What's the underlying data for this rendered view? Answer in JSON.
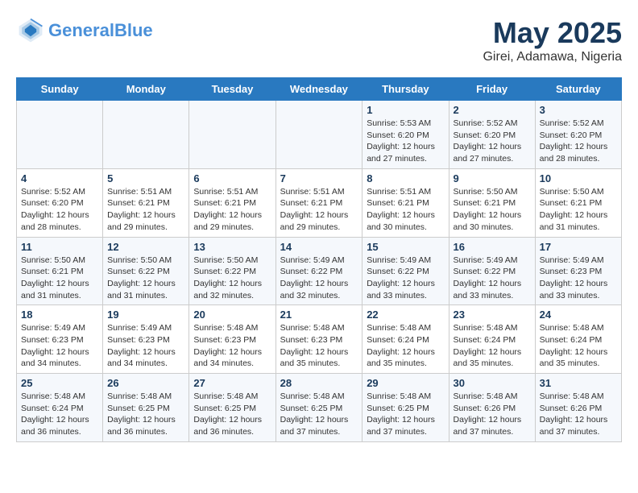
{
  "logo": {
    "text_general": "General",
    "text_blue": "Blue"
  },
  "header": {
    "month": "May 2025",
    "location": "Girei, Adamawa, Nigeria"
  },
  "weekdays": [
    "Sunday",
    "Monday",
    "Tuesday",
    "Wednesday",
    "Thursday",
    "Friday",
    "Saturday"
  ],
  "weeks": [
    [
      {
        "day": "",
        "info": ""
      },
      {
        "day": "",
        "info": ""
      },
      {
        "day": "",
        "info": ""
      },
      {
        "day": "",
        "info": ""
      },
      {
        "day": "1",
        "info": "Sunrise: 5:53 AM\nSunset: 6:20 PM\nDaylight: 12 hours\nand 27 minutes."
      },
      {
        "day": "2",
        "info": "Sunrise: 5:52 AM\nSunset: 6:20 PM\nDaylight: 12 hours\nand 27 minutes."
      },
      {
        "day": "3",
        "info": "Sunrise: 5:52 AM\nSunset: 6:20 PM\nDaylight: 12 hours\nand 28 minutes."
      }
    ],
    [
      {
        "day": "4",
        "info": "Sunrise: 5:52 AM\nSunset: 6:20 PM\nDaylight: 12 hours\nand 28 minutes."
      },
      {
        "day": "5",
        "info": "Sunrise: 5:51 AM\nSunset: 6:21 PM\nDaylight: 12 hours\nand 29 minutes."
      },
      {
        "day": "6",
        "info": "Sunrise: 5:51 AM\nSunset: 6:21 PM\nDaylight: 12 hours\nand 29 minutes."
      },
      {
        "day": "7",
        "info": "Sunrise: 5:51 AM\nSunset: 6:21 PM\nDaylight: 12 hours\nand 29 minutes."
      },
      {
        "day": "8",
        "info": "Sunrise: 5:51 AM\nSunset: 6:21 PM\nDaylight: 12 hours\nand 30 minutes."
      },
      {
        "day": "9",
        "info": "Sunrise: 5:50 AM\nSunset: 6:21 PM\nDaylight: 12 hours\nand 30 minutes."
      },
      {
        "day": "10",
        "info": "Sunrise: 5:50 AM\nSunset: 6:21 PM\nDaylight: 12 hours\nand 31 minutes."
      }
    ],
    [
      {
        "day": "11",
        "info": "Sunrise: 5:50 AM\nSunset: 6:21 PM\nDaylight: 12 hours\nand 31 minutes."
      },
      {
        "day": "12",
        "info": "Sunrise: 5:50 AM\nSunset: 6:22 PM\nDaylight: 12 hours\nand 31 minutes."
      },
      {
        "day": "13",
        "info": "Sunrise: 5:50 AM\nSunset: 6:22 PM\nDaylight: 12 hours\nand 32 minutes."
      },
      {
        "day": "14",
        "info": "Sunrise: 5:49 AM\nSunset: 6:22 PM\nDaylight: 12 hours\nand 32 minutes."
      },
      {
        "day": "15",
        "info": "Sunrise: 5:49 AM\nSunset: 6:22 PM\nDaylight: 12 hours\nand 33 minutes."
      },
      {
        "day": "16",
        "info": "Sunrise: 5:49 AM\nSunset: 6:22 PM\nDaylight: 12 hours\nand 33 minutes."
      },
      {
        "day": "17",
        "info": "Sunrise: 5:49 AM\nSunset: 6:23 PM\nDaylight: 12 hours\nand 33 minutes."
      }
    ],
    [
      {
        "day": "18",
        "info": "Sunrise: 5:49 AM\nSunset: 6:23 PM\nDaylight: 12 hours\nand 34 minutes."
      },
      {
        "day": "19",
        "info": "Sunrise: 5:49 AM\nSunset: 6:23 PM\nDaylight: 12 hours\nand 34 minutes."
      },
      {
        "day": "20",
        "info": "Sunrise: 5:48 AM\nSunset: 6:23 PM\nDaylight: 12 hours\nand 34 minutes."
      },
      {
        "day": "21",
        "info": "Sunrise: 5:48 AM\nSunset: 6:23 PM\nDaylight: 12 hours\nand 35 minutes."
      },
      {
        "day": "22",
        "info": "Sunrise: 5:48 AM\nSunset: 6:24 PM\nDaylight: 12 hours\nand 35 minutes."
      },
      {
        "day": "23",
        "info": "Sunrise: 5:48 AM\nSunset: 6:24 PM\nDaylight: 12 hours\nand 35 minutes."
      },
      {
        "day": "24",
        "info": "Sunrise: 5:48 AM\nSunset: 6:24 PM\nDaylight: 12 hours\nand 35 minutes."
      }
    ],
    [
      {
        "day": "25",
        "info": "Sunrise: 5:48 AM\nSunset: 6:24 PM\nDaylight: 12 hours\nand 36 minutes."
      },
      {
        "day": "26",
        "info": "Sunrise: 5:48 AM\nSunset: 6:25 PM\nDaylight: 12 hours\nand 36 minutes."
      },
      {
        "day": "27",
        "info": "Sunrise: 5:48 AM\nSunset: 6:25 PM\nDaylight: 12 hours\nand 36 minutes."
      },
      {
        "day": "28",
        "info": "Sunrise: 5:48 AM\nSunset: 6:25 PM\nDaylight: 12 hours\nand 37 minutes."
      },
      {
        "day": "29",
        "info": "Sunrise: 5:48 AM\nSunset: 6:25 PM\nDaylight: 12 hours\nand 37 minutes."
      },
      {
        "day": "30",
        "info": "Sunrise: 5:48 AM\nSunset: 6:26 PM\nDaylight: 12 hours\nand 37 minutes."
      },
      {
        "day": "31",
        "info": "Sunrise: 5:48 AM\nSunset: 6:26 PM\nDaylight: 12 hours\nand 37 minutes."
      }
    ]
  ]
}
